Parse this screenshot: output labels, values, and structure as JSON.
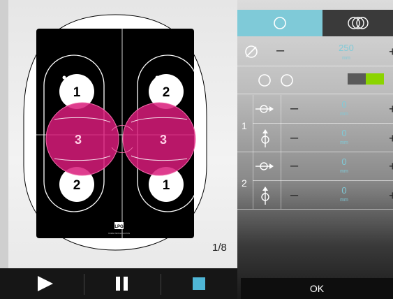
{
  "stage": {
    "page_counter": "1/8",
    "logo_text": "LPG",
    "logo_caption": "HUMAN SKIN EVOLUTION",
    "zones": [
      {
        "id": "zone-1-top",
        "label": "1"
      },
      {
        "id": "zone-2-top",
        "label": "2"
      },
      {
        "id": "zone-3-left",
        "label": "3"
      },
      {
        "id": "zone-3-right",
        "label": "3"
      },
      {
        "id": "zone-2-bottom",
        "label": "2"
      },
      {
        "id": "zone-1-bottom",
        "label": "1"
      }
    ]
  },
  "transport": {
    "play": "play-icon",
    "pause": "pause-icon",
    "stop": "stop-icon",
    "stop_color": "#4fb6d6"
  },
  "panel": {
    "tabs": {
      "single": "single-circle-icon",
      "multi": "multi-circle-icon"
    },
    "diameter": {
      "value": "250",
      "unit": "mm"
    },
    "toggle": {
      "accent": "#8bd400"
    },
    "groups": [
      {
        "label": "1",
        "rows": [
          {
            "value": "0",
            "unit": "mm"
          },
          {
            "value": "0",
            "unit": "mm"
          }
        ]
      },
      {
        "label": "2",
        "rows": [
          {
            "value": "0",
            "unit": "mm"
          },
          {
            "value": "0",
            "unit": "mm"
          }
        ]
      }
    ],
    "ok_label": "OK"
  },
  "colors": {
    "accent": "#7fcad8",
    "magenta": "#d81b7a",
    "board": "#000000"
  }
}
